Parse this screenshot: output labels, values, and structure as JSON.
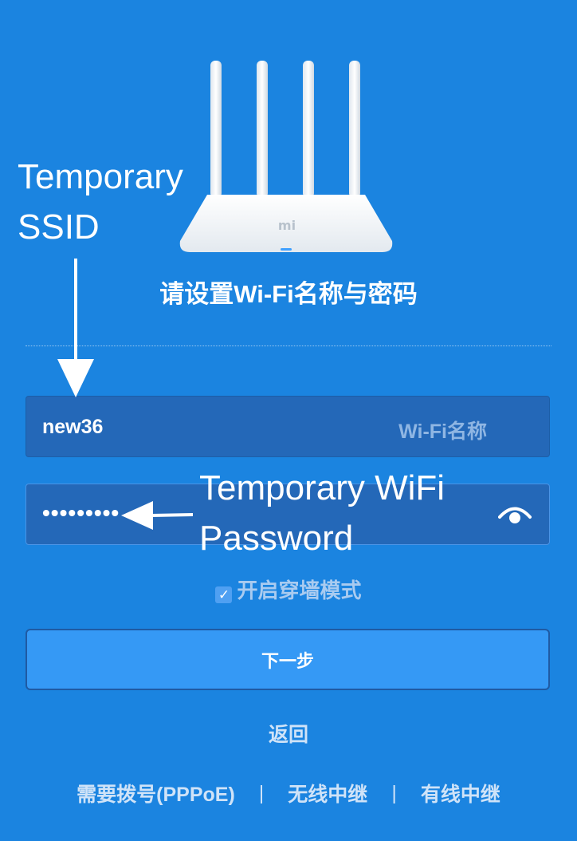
{
  "heading": "请设置Wi-Fi名称与密码",
  "router_logo": "mi",
  "ssid_field": {
    "value": "new36",
    "placeholder": "Wi-Fi名称"
  },
  "password_field": {
    "value": "•••••••••",
    "toggle_icon": "eye-icon"
  },
  "wall_mode": {
    "label": "开启穿墙模式",
    "checked": true
  },
  "next_button": "下一步",
  "back_link": "返回",
  "bottom_links": [
    "需要拨号(PPPoE)",
    "|",
    "无线中继",
    "|",
    "有线中继"
  ],
  "annotations": {
    "ssid": [
      "Temporary",
      "SSID"
    ],
    "password": [
      "Temporary WiFi",
      "Password"
    ]
  },
  "colors": {
    "background": "#1b84e0",
    "field": "#2468b8",
    "button": "#3599f5"
  }
}
